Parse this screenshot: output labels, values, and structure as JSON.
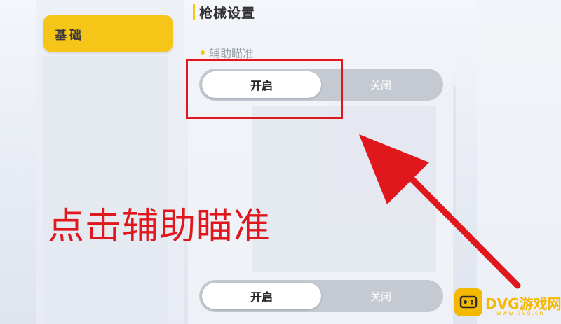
{
  "sidebar": {
    "tab_label": "基础"
  },
  "panel": {
    "title": "枪械设置",
    "subsection_label": "辅助瞄准",
    "toggle_1": {
      "on_label": "开启",
      "off_label": "关闭"
    },
    "toggle_2": {
      "on_label": "开启",
      "off_label": "关闭"
    }
  },
  "annotation": {
    "instruction": "点击辅助瞄准"
  },
  "watermark": {
    "name": "DVG游戏网",
    "domain": "www.dvg.cn"
  },
  "colors": {
    "accent_yellow": "#f5c518",
    "annotation_red": "#e0171c",
    "toggle_track": "#c5c9d1"
  }
}
